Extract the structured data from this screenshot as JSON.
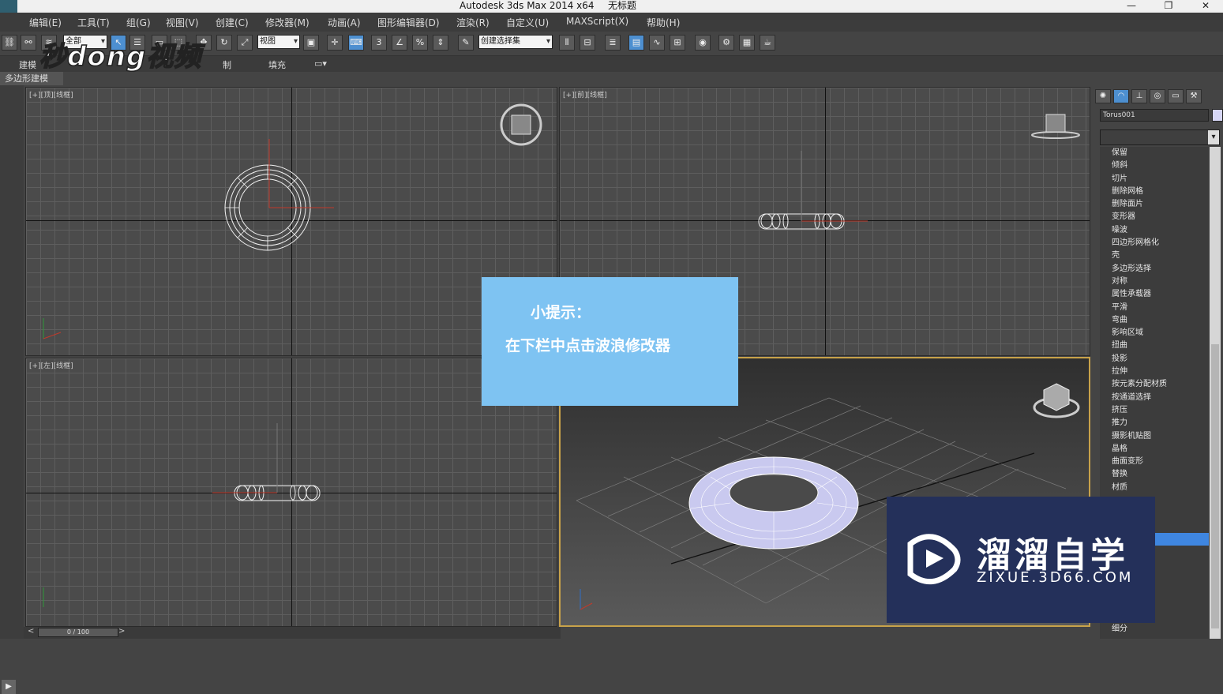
{
  "window": {
    "title": "Autodesk 3ds Max  2014 x64",
    "document": "无标题",
    "controls": [
      "—",
      "❐",
      "✕"
    ]
  },
  "menu": [
    "编辑(E)",
    "工具(T)",
    "组(G)",
    "视图(V)",
    "创建(C)",
    "修改器(M)",
    "动画(A)",
    "图形编辑器(D)",
    "渲染(R)",
    "自定义(U)",
    "MAXScript(X)",
    "帮助(H)"
  ],
  "toolbar": {
    "selection_filter": "全部",
    "ref_coord": "视图",
    "named_selection": "创建选择集",
    "snap_label": "3"
  },
  "ribbon": {
    "tabs": [
      "建模",
      "制",
      "填充"
    ],
    "subtab": "多边形建模"
  },
  "viewports": {
    "top": "[+][顶][线框]",
    "front": "[+][前][线框]",
    "left": "[+][左][线框]"
  },
  "command_panel": {
    "object_name": "Torus001",
    "modifiers": [
      "保留",
      "倾斜",
      "切片",
      "删除网格",
      "删除面片",
      "变形器",
      "噪波",
      "四边形网格化",
      "壳",
      "多边形选择",
      "对称",
      "属性承载器",
      "平滑",
      "弯曲",
      "影响区域",
      "扭曲",
      "投影",
      "拉伸",
      "按元素分配材质",
      "按通道选择",
      "挤压",
      "推力",
      "摄影机贴图",
      "晶格",
      "曲面变形",
      "替换",
      "材质",
      "",
      "",
      "",
      "",
      "",
      "",
      "",
      "",
      "",
      "",
      "细分"
    ],
    "selected_index": 30
  },
  "tip": {
    "heading": "小提示：",
    "body": "在下栏中点击波浪修改器"
  },
  "watermarks": {
    "top_left": "秒dong视频",
    "brand_cn": "溜溜自学",
    "brand_en": "ZIXUE.3D66.COM"
  },
  "timeline": {
    "frame": "0 / 100",
    "prev": "<",
    "next": ">"
  },
  "colors": {
    "tip_bg": "#7ec3f2",
    "selection_blue": "#3f86e0",
    "brand_bg": "#24305a",
    "active_viewport": "#c8a24a"
  }
}
